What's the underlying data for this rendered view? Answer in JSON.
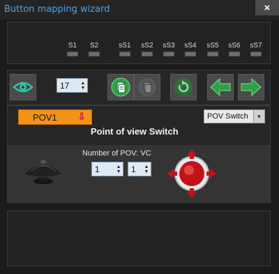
{
  "window": {
    "title": "Button mapping wizard",
    "close_label": "×"
  },
  "slots": [
    "S1",
    "S2",
    "sS1",
    "sS2",
    "sS3",
    "sS4",
    "sS5",
    "sS6",
    "sS7"
  ],
  "toolbar": {
    "number_value": "17",
    "icons": {
      "view": "eye-icon",
      "copy": "copy-icon",
      "paste": "paste-icon",
      "refresh": "refresh-icon",
      "prev": "arrow-left-icon",
      "next": "arrow-right-icon"
    }
  },
  "pov": {
    "tag_label": "POV1",
    "tag_arrow": "⇩",
    "type_select": "POV Switch",
    "heading": "Point of view Switch",
    "count_label": "Number of POV: VC",
    "count_value_1": "1",
    "count_value_2": "1"
  },
  "colors": {
    "accent_blue": "#4fa3e6",
    "orange": "#f2941a",
    "green": "#2ea04a",
    "red": "#d4161b"
  }
}
